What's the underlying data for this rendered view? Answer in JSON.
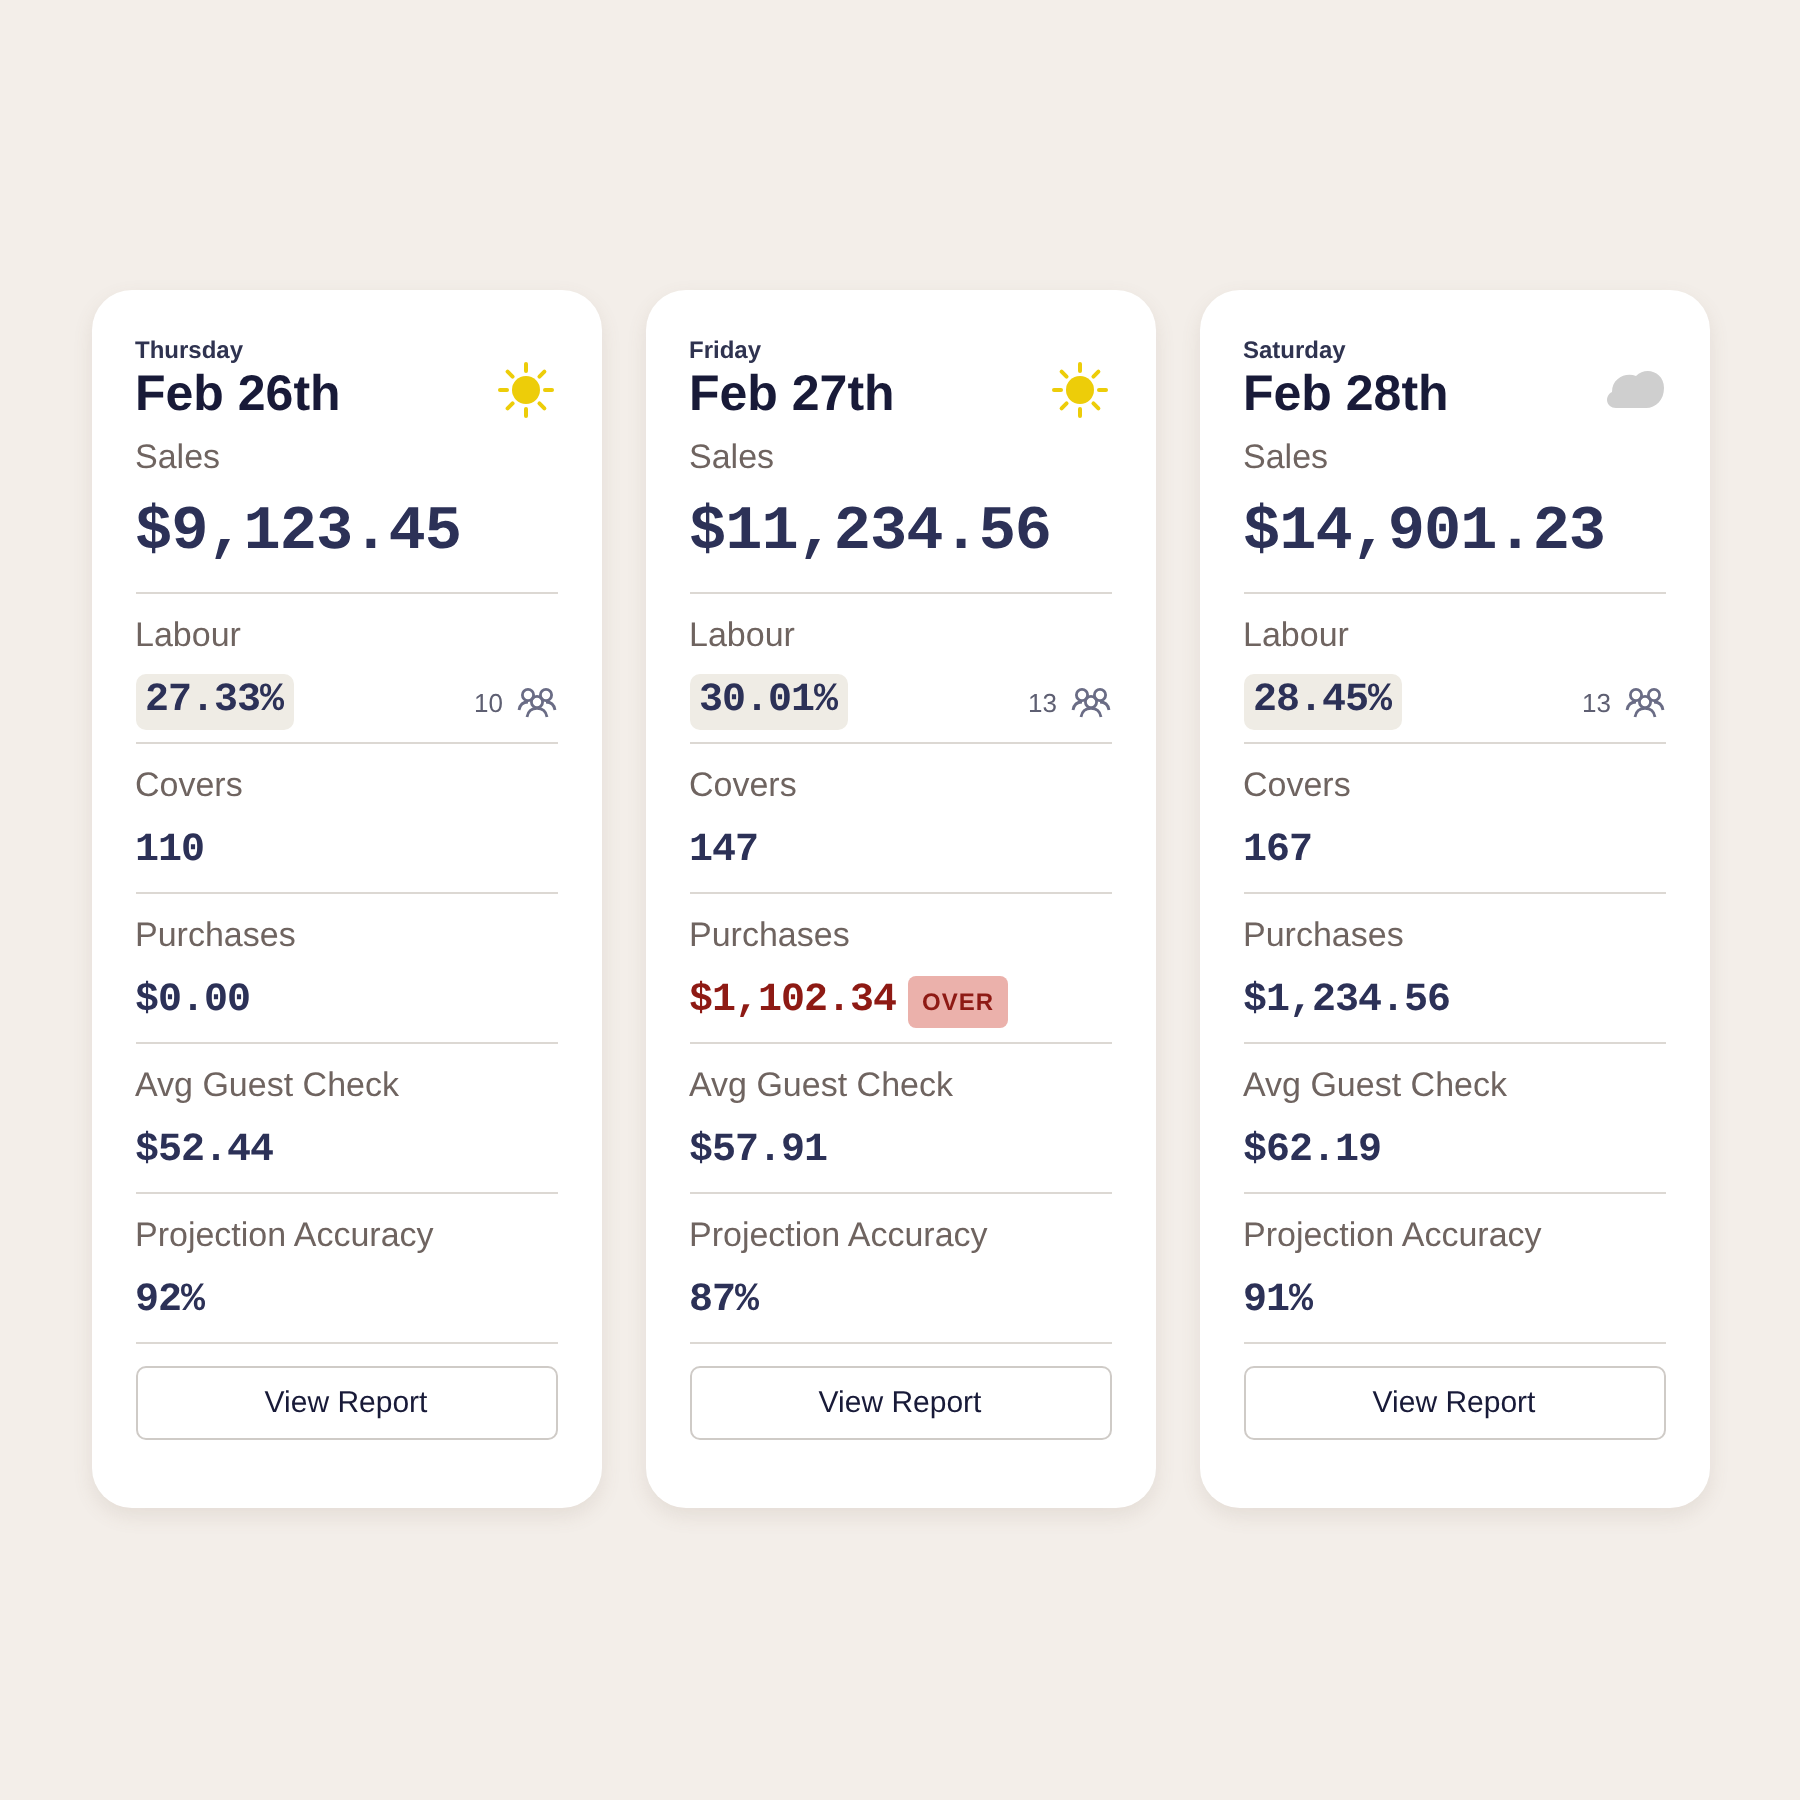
{
  "days": [
    {
      "weekday": "Thursday",
      "date": "Feb 26th",
      "weather": {
        "kind": "sunny"
      },
      "metrics": [
        {
          "kind": "large",
          "label": "Sales",
          "value": "$9,123.45"
        },
        {
          "kind": "chip",
          "label": "Labour",
          "value": "27.33%",
          "staff": "10"
        },
        {
          "kind": "plain",
          "label": "Covers",
          "value": "110"
        },
        {
          "kind": "plain",
          "label": "Purchases",
          "value": "$0.00",
          "over": false
        },
        {
          "kind": "plain",
          "label": "Avg Guest Check",
          "value": "$52.44"
        },
        {
          "kind": "plain",
          "label": "Projection Accuracy",
          "value": "92%"
        }
      ],
      "button": "View Report"
    },
    {
      "weekday": "Friday",
      "date": "Feb 27th",
      "weather": {
        "kind": "sunny"
      },
      "metrics": [
        {
          "kind": "large",
          "label": "Sales",
          "value": "$11,234.56"
        },
        {
          "kind": "chip",
          "label": "Labour",
          "value": "30.01%",
          "staff": "13"
        },
        {
          "kind": "plain",
          "label": "Covers",
          "value": "147"
        },
        {
          "kind": "plain",
          "label": "Purchases",
          "value": "$1,102.34",
          "over": true,
          "badge": "OVER"
        },
        {
          "kind": "plain",
          "label": "Avg Guest Check",
          "value": "$57.91"
        },
        {
          "kind": "plain",
          "label": "Projection Accuracy",
          "value": "87%"
        }
      ],
      "button": "View Report"
    },
    {
      "weekday": "Saturday",
      "date": "Feb 28th",
      "weather": {
        "kind": "cloudy"
      },
      "metrics": [
        {
          "kind": "large",
          "label": "Sales",
          "value": "$14,901.23"
        },
        {
          "kind": "chip",
          "label": "Labour",
          "value": "28.45%",
          "staff": "13"
        },
        {
          "kind": "plain",
          "label": "Covers",
          "value": "167"
        },
        {
          "kind": "plain",
          "label": "Purchases",
          "value": "$1,234.56",
          "over": false
        },
        {
          "kind": "plain",
          "label": "Avg Guest Check",
          "value": "$62.19"
        },
        {
          "kind": "plain",
          "label": "Projection Accuracy",
          "value": "91%"
        }
      ],
      "button": "View Report"
    }
  ]
}
